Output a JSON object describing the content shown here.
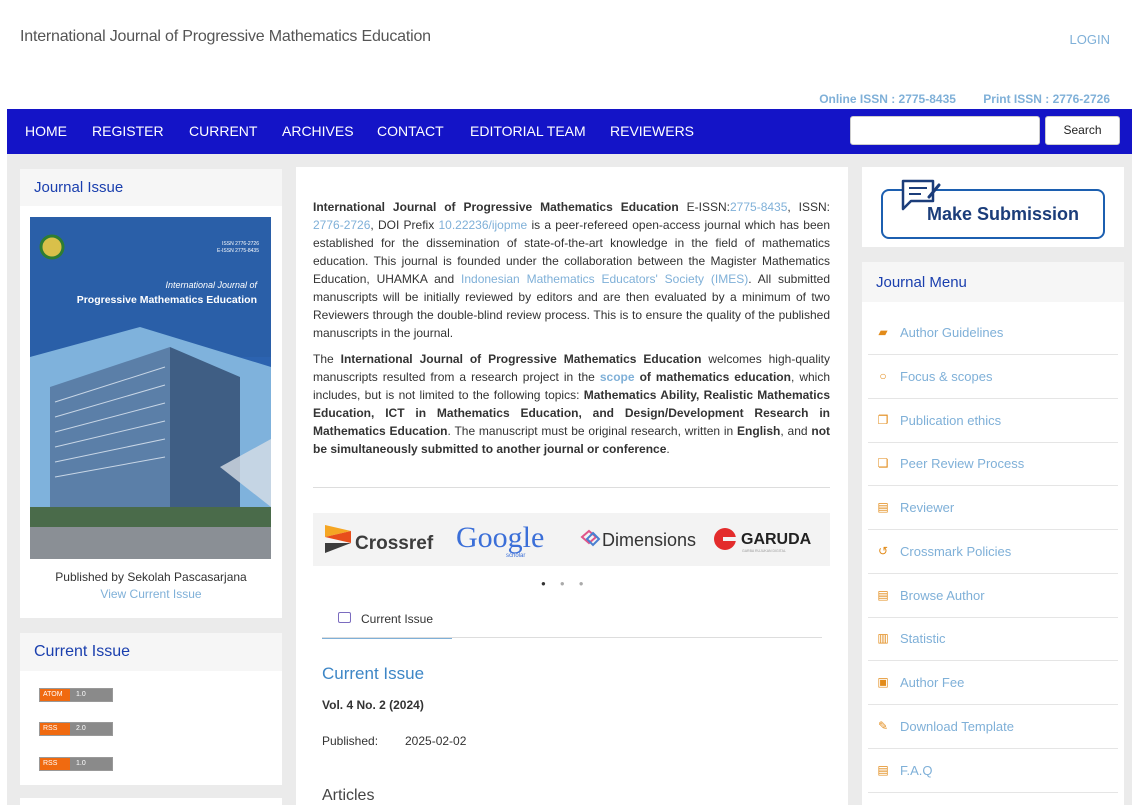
{
  "header": {
    "site_title": "International Journal of Progressive Mathematics Education",
    "login": "LOGIN",
    "online_issn": "Online ISSN : 2775-8435",
    "print_issn": "Print ISSN : 2776-2726"
  },
  "nav": {
    "items": [
      "HOME",
      "REGISTER",
      "CURRENT",
      "ARCHIVES",
      "CONTACT",
      "EDITORIAL TEAM",
      "REVIEWERS"
    ],
    "search_button": "Search",
    "search_placeholder": ""
  },
  "left": {
    "journal_issue_title": "Journal Issue",
    "cover": {
      "issn_line1": "ISSN 2776-2726",
      "issn_line2": "E-ISSN 2775-8435",
      "title_line1": "International Journal of",
      "title_line2": "Progressive Mathematics Education"
    },
    "published_by": "Published by Sekolah Pascasarjana",
    "view_current": "View Current Issue",
    "current_issue_title": "Current Issue",
    "feeds": [
      {
        "left": "ATOM",
        "right": "1.0"
      },
      {
        "left": "RSS",
        "right": "2.0"
      },
      {
        "left": "RSS",
        "right": "1.0"
      }
    ]
  },
  "intro": {
    "p1_journal": "International Journal of Progressive Mathematics Education",
    "p1_eissn_label": " E-ISSN:",
    "p1_eissn": "2775-8435",
    "p1_issn_label": ", ISSN: ",
    "p1_issn": "2776-2726",
    "p1_doi_label": ", DOI Prefix ",
    "p1_doi": "10.22236/ijopme",
    "p1_text1": " is a peer-refereed open-access journal which has been established for the dissemination of state-of-the-art knowledge in the field of mathematics education. This journal is founded under the collaboration between the Magister Mathematics Education, UHAMKA and ",
    "p1_imes": "Indonesian Mathematics Educators' Society (IMES)",
    "p1_text2": ". All submitted manuscripts will be initially reviewed by editors and are then evaluated by a minimum of two Reviewers through the double-blind review process. This is to ensure the quality of the published manuscripts in the journal.",
    "p2_the": "The ",
    "p2_journal": "International Journal of Progressive Mathematics Education",
    "p2_text1": " welcomes high-quality manuscripts resulted from a research project in the ",
    "p2_scope": "scope",
    "p2_of": " of mathematics education",
    "p2_text2": ", which includes, but is not limited to the following topics: ",
    "p2_topics": "Mathematics Ability, Realistic Mathematics Education, ICT in Mathematics Education, and Design/Development Research in Mathematics Education",
    "p2_text3": ". The manuscript must be original research, written in ",
    "p2_english": "English",
    "p2_and": ", and ",
    "p2_notsim": "not be simultaneously submitted to another journal or conference",
    "p2_end": "."
  },
  "logos": {
    "crossref": "Crossref",
    "google": "Google",
    "scholar": "scholar",
    "dimensions": "Dimensions",
    "garuda": "GARUDA",
    "garuda_sub": "GARBA RUJUKAN DIGITAL"
  },
  "current": {
    "tab": "Current Issue",
    "title": "Current Issue",
    "volume": "Vol. 4 No. 2 (2024)",
    "published_label": "Published:",
    "published_value": "2025-02-02",
    "articles": "Articles"
  },
  "right": {
    "make_submission": "Make Submission",
    "journal_menu": "Journal Menu",
    "menu": [
      {
        "icon": "book-icon",
        "glyph": "▰",
        "label": "Author Guidelines"
      },
      {
        "icon": "circle-icon",
        "glyph": "○",
        "label": "Focus & scopes"
      },
      {
        "icon": "copy-icon",
        "glyph": "❐",
        "label": "Publication ethics"
      },
      {
        "icon": "clipboard-icon",
        "glyph": "❏",
        "label": "Peer Review Process"
      },
      {
        "icon": "file-icon",
        "glyph": "▤",
        "label": "Reviewer"
      },
      {
        "icon": "history-icon",
        "glyph": "↺",
        "label": "Crossmark Policies"
      },
      {
        "icon": "file-text-icon",
        "glyph": "▤",
        "label": "Browse Author"
      },
      {
        "icon": "bar-chart-icon",
        "glyph": "▥",
        "label": "Statistic"
      },
      {
        "icon": "money-icon",
        "glyph": "▣",
        "label": "Author Fee"
      },
      {
        "icon": "edit-icon",
        "glyph": "✎",
        "label": "Download Template"
      },
      {
        "icon": "file-text-icon",
        "glyph": "▤",
        "label": "F.A.Q"
      }
    ]
  },
  "colors": {
    "nav_bg": "#1414c7",
    "link": "#7fb0d8",
    "heading": "#1a3fae",
    "icon_orange": "#e28b1a"
  }
}
